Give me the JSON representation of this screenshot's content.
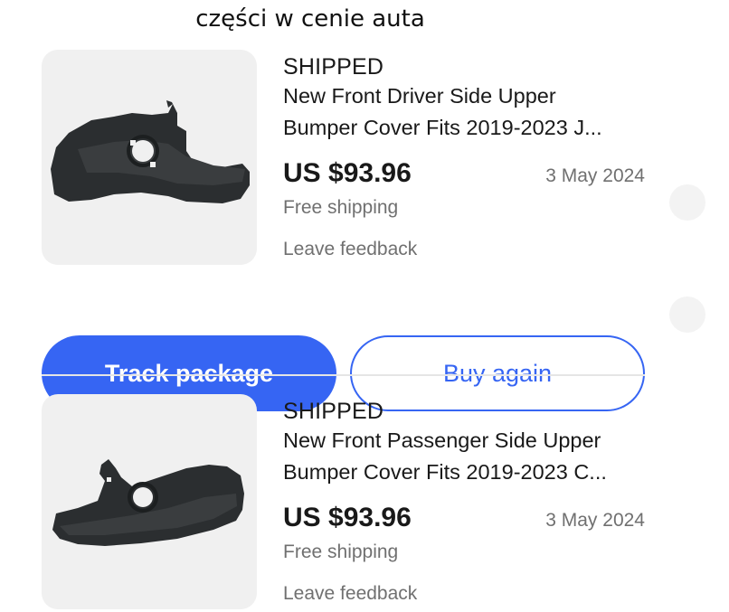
{
  "caption": "części w cenie auta",
  "orders": [
    {
      "status": "SHIPPED",
      "title_line1": "New Front Driver Side Upper",
      "title_line2": "Bumper Cover Fits 2019-2023 J...",
      "price": "US $93.96",
      "date": "3 May 2024",
      "shipping": "Free shipping",
      "feedback": "Leave feedback",
      "image_icon": "bumper-driver-side-icon"
    },
    {
      "status": "SHIPPED",
      "title_line1": "New Front Passenger Side Upper",
      "title_line2": "Bumper Cover Fits 2019-2023 C...",
      "price": "US $93.96",
      "date": "3 May 2024",
      "shipping": "Free shipping",
      "feedback": "Leave feedback",
      "image_icon": "bumper-passenger-side-icon"
    }
  ],
  "actions": {
    "track_label": "Track package",
    "buy_again_label": "Buy again"
  },
  "colors": {
    "accent": "#3665f3",
    "muted_text": "#707070",
    "thumb_bg": "#f0f0f0"
  }
}
